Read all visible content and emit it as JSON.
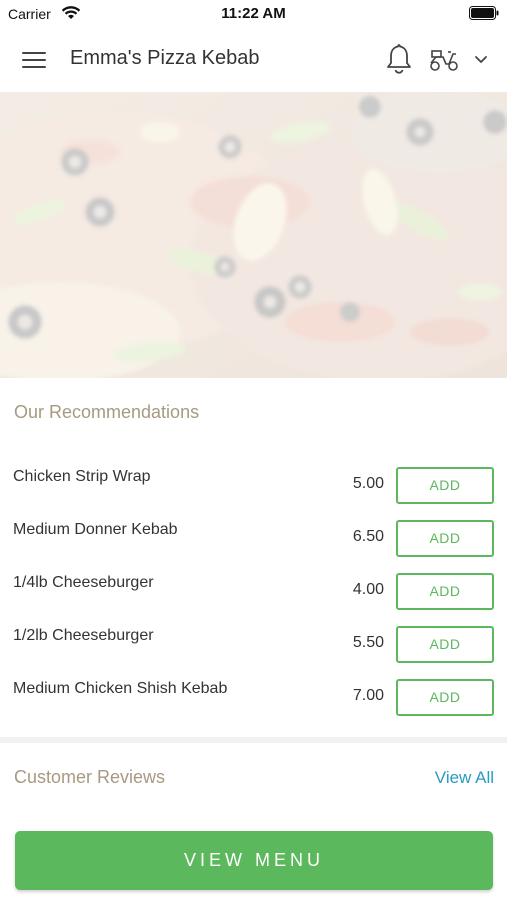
{
  "status_bar": {
    "carrier": "Carrier",
    "time": "11:22 AM"
  },
  "header": {
    "title": "Emma's Pizza Kebab",
    "icons": [
      "menu-icon",
      "bell-icon",
      "delivery-scooter-icon",
      "chevron-down-icon"
    ]
  },
  "hero": {
    "image": "pizza-image"
  },
  "recommendations": {
    "title": "Our Recommendations",
    "add_label": "ADD",
    "items": [
      {
        "name": "Chicken Strip Wrap",
        "price": "5.00"
      },
      {
        "name": "Medium Donner Kebab",
        "price": "6.50"
      },
      {
        "name": "1/4lb Cheeseburger",
        "price": "4.00"
      },
      {
        "name": "1/2lb Cheeseburger",
        "price": "5.50"
      },
      {
        "name": "Medium Chicken Shish Kebab",
        "price": "7.00"
      }
    ]
  },
  "reviews": {
    "title": "Customer Reviews",
    "view_all": "View All"
  },
  "view_menu": {
    "label": "VIEW MENU"
  },
  "colors": {
    "accent_green": "#5cb85c",
    "section_title": "#a69a80",
    "link_blue": "#2a9bc0"
  }
}
